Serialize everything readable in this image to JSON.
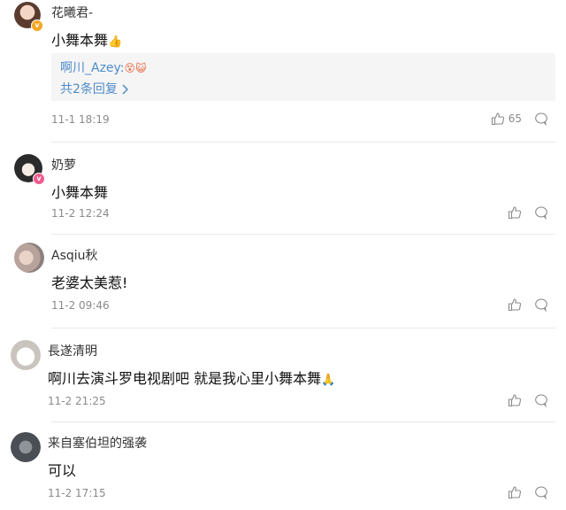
{
  "comments": [
    {
      "user": "花曦君-",
      "text": "小舞本舞",
      "emoji": "👍",
      "time": "11-1 18:19",
      "likes": "65",
      "badge_color": "#f5a623",
      "reply": {
        "name": "啊川_Azey:",
        "emojis": "😵😺",
        "more": "共2条回复",
        "chevron": "chevron-right-icon"
      }
    },
    {
      "user": "奶萝",
      "text": "小舞本舞",
      "time": "11-2 12:24",
      "likes": "",
      "badge_color": "#f15b8c"
    },
    {
      "user": "Asqiu秋",
      "text": "老婆太美惹!",
      "time": "11-2 09:46",
      "likes": ""
    },
    {
      "user": "長遂清明",
      "text": "啊川去演斗罗电视剧吧 就是我心里小舞本舞",
      "emoji": "🙏",
      "time": "11-2 21:25",
      "likes": ""
    },
    {
      "user": "来自塞伯坦的强袭",
      "text": "可以",
      "time": "11-2 17:15",
      "likes": ""
    }
  ]
}
